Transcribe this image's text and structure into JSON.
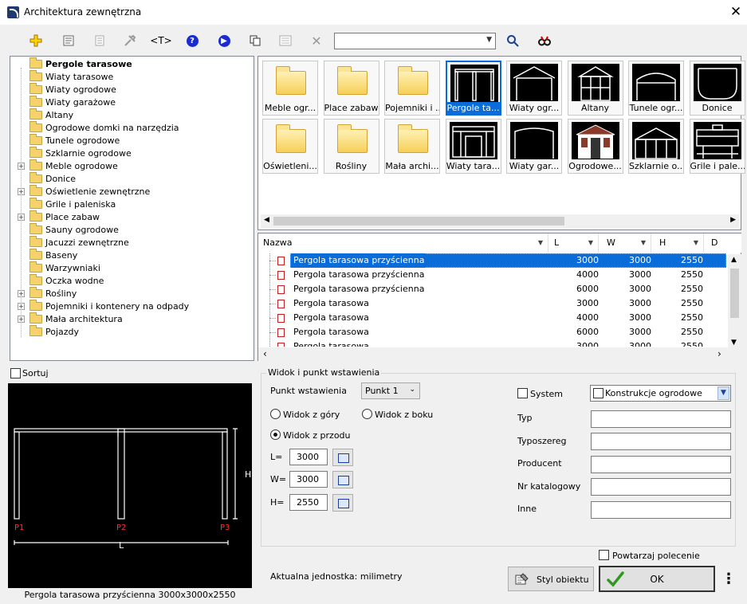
{
  "window": {
    "title": "Architektura zewnętrzna"
  },
  "toolbar": {
    "search_value": ""
  },
  "tree": {
    "items": [
      {
        "label": "Pergole tarasowe",
        "selected": true,
        "expandable": false
      },
      {
        "label": "Wiaty tarasowe",
        "expandable": false
      },
      {
        "label": "Wiaty ogrodowe",
        "expandable": false
      },
      {
        "label": "Wiaty garażowe",
        "expandable": false
      },
      {
        "label": "Altany",
        "expandable": false
      },
      {
        "label": "Ogrodowe domki na narzędzia",
        "expandable": false
      },
      {
        "label": "Tunele ogrodowe",
        "expandable": false
      },
      {
        "label": "Szklarnie ogrodowe",
        "expandable": false
      },
      {
        "label": "Meble ogrodowe",
        "expandable": true
      },
      {
        "label": "Donice",
        "expandable": false
      },
      {
        "label": "Oświetlenie zewnętrzne",
        "expandable": true
      },
      {
        "label": "Grile i paleniska",
        "expandable": false
      },
      {
        "label": "Place zabaw",
        "expandable": true
      },
      {
        "label": "Sauny ogrodowe",
        "expandable": false
      },
      {
        "label": "Jacuzzi zewnętrzne",
        "expandable": false
      },
      {
        "label": "Baseny",
        "expandable": false
      },
      {
        "label": "Warzywniaki",
        "expandable": false
      },
      {
        "label": "Oczka wodne",
        "expandable": false
      },
      {
        "label": "Rośliny",
        "expandable": true
      },
      {
        "label": "Pojemniki i kontenery na odpady",
        "expandable": true
      },
      {
        "label": "Mała architektura",
        "expandable": true
      },
      {
        "label": "Pojazdy",
        "expandable": false
      }
    ]
  },
  "gallery": {
    "tiles": [
      {
        "label": "Meble ogr...",
        "kind": "folder"
      },
      {
        "label": "Place zabaw",
        "kind": "folder"
      },
      {
        "label": "Pojemniki i ...",
        "kind": "folder"
      },
      {
        "label": "Pergole ta...",
        "kind": "pergola",
        "selected": true
      },
      {
        "label": "Wiaty ogr...",
        "kind": "shed"
      },
      {
        "label": "Altany",
        "kind": "gazebo"
      },
      {
        "label": "Tunele ogr...",
        "kind": "tunnel"
      },
      {
        "label": "Donice",
        "kind": "planter"
      },
      {
        "label": "Oświetleni...",
        "kind": "folder"
      },
      {
        "label": "Rośliny",
        "kind": "folder"
      },
      {
        "label": "Mała archi...",
        "kind": "folder"
      },
      {
        "label": "Wiaty tara...",
        "kind": "carport"
      },
      {
        "label": "Wiaty gar...",
        "kind": "garage"
      },
      {
        "label": "Ogrodowe...",
        "kind": "house"
      },
      {
        "label": "Szklarnie o...",
        "kind": "greenhouse"
      },
      {
        "label": "Grile i pale...",
        "kind": "grill"
      }
    ]
  },
  "table": {
    "columns": [
      "Nazwa",
      "L",
      "W",
      "H",
      "D"
    ],
    "rows": [
      {
        "name": "Pergola tarasowa przyścienna",
        "L": "3000",
        "W": "3000",
        "H": "2550",
        "selected": true
      },
      {
        "name": "Pergola tarasowa przyścienna",
        "L": "4000",
        "W": "3000",
        "H": "2550"
      },
      {
        "name": "Pergola tarasowa przyścienna",
        "L": "6000",
        "W": "3000",
        "H": "2550"
      },
      {
        "name": "Pergola tarasowa",
        "L": "3000",
        "W": "3000",
        "H": "2550"
      },
      {
        "name": "Pergola tarasowa",
        "L": "4000",
        "W": "3000",
        "H": "2550"
      },
      {
        "name": "Pergola tarasowa",
        "L": "6000",
        "W": "3000",
        "H": "2550"
      },
      {
        "name": "Pergola tarasowa",
        "L": "3000",
        "W": "3000",
        "H": "2550",
        "partial": true
      }
    ]
  },
  "sort": {
    "label": "Sortuj",
    "checked": false
  },
  "preview": {
    "caption": "Pergola tarasowa przyścienna 3000x3000x2550",
    "points": [
      "P1",
      "P2",
      "P3"
    ],
    "dim_h": "H",
    "dim_l": "L",
    "color": "#ff3030"
  },
  "view": {
    "group_title": "Widok i punkt wstawienia",
    "insert_point_label": "Punkt wstawienia",
    "insert_point_value": "Punkt 1",
    "view_top": "Widok z góry",
    "view_side": "Widok z boku",
    "view_front": "Widok z przodu",
    "selected_view": "front",
    "L_label": "L=",
    "L_value": "3000",
    "W_label": "W=",
    "W_value": "3000",
    "H_label": "H=",
    "H_value": "2550"
  },
  "props": {
    "system_label": "System",
    "system_checked": false,
    "system_value": "Konstrukcje ogrodowe",
    "typ_label": "Typ",
    "typoszereg_label": "Typoszereg",
    "producent_label": "Producent",
    "nr_katalogowy_label": "Nr katalogowy",
    "inne_label": "Inne",
    "typ_value": "",
    "typoszereg_value": "",
    "producent_value": "",
    "nr_katalogowy_value": "",
    "inne_value": ""
  },
  "footer": {
    "repeat_label": "Powtarzaj polecenie",
    "repeat_checked": false,
    "unit_text": "Aktualna jednostka: milimetry",
    "style_button": "Styl obiektu",
    "ok_button": "OK",
    "more_button": "⋮"
  },
  "colors": {
    "accent": "#0a6cd8",
    "ok_check": "#2f9a1e"
  }
}
